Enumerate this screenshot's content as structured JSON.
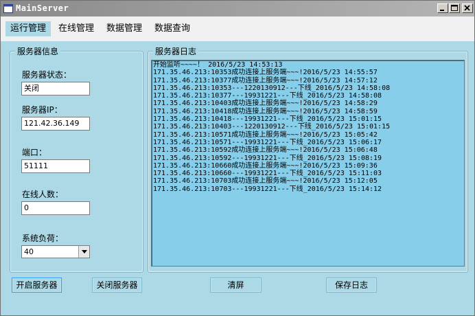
{
  "window": {
    "title": "MainServer",
    "controls": {
      "minimize": "minimize-icon",
      "maximize": "maximize-icon",
      "close": "close-icon"
    }
  },
  "menu": {
    "items": [
      {
        "label": "运行管理",
        "active": true
      },
      {
        "label": "在线管理"
      },
      {
        "label": "数据管理"
      },
      {
        "label": "数据查询"
      }
    ]
  },
  "server_info": {
    "title": "服务器信息",
    "status_label": "服务器状态：",
    "status_value": "关闭",
    "ip_label": "服务器IP：",
    "ip_value": "121.42.36.149",
    "port_label": "端口：",
    "port_value": "51111",
    "online_label": "在线人数：",
    "online_value": "0",
    "load_label": "系统负荷：",
    "load_value": "40"
  },
  "server_log": {
    "title": "服务器日志",
    "lines": [
      "开始监听~~~~！ 2016/5/23 14:53:13",
      "171.35.46.213:10353成功连接上服务端~~~!2016/5/23 14:55:57",
      "171.35.46.213:10377成功连接上服务端~~~!2016/5/23 14:57:12",
      "171.35.46.213:10353---1220130912---下线_2016/5/23 14:58:08",
      "171.35.46.213:10377---19931221---下线_2016/5/23 14:58:08",
      "171.35.46.213:10403成功连接上服务端~~~!2016/5/23 14:58:29",
      "171.35.46.213:10418成功连接上服务端~~~!2016/5/23 14:58:59",
      "171.35.46.213:10418---19931221---下线_2016/5/23 15:01:15",
      "171.35.46.213:10403---1220130912---下线_2016/5/23 15:01:15",
      "171.35.46.213:10571成功连接上服务端~~~!2016/5/23 15:05:42",
      "171.35.46.213:10571---19931221---下线_2016/5/23 15:06:17",
      "171.35.46.213:10592成功连接上服务端~~~!2016/5/23 15:06:48",
      "171.35.46.213:10592---19931221---下线_2016/5/23 15:08:19",
      "171.35.46.213:10660成功连接上服务端~~~!2016/5/23 15:09:36",
      "171.35.46.213:10660---19931221---下线_2016/5/23 15:11:03",
      "171.35.46.213:10703成功连接上服务端~~~!2016/5/23 15:12:05",
      "171.35.46.213:10703---19931221---下线_2016/5/23 15:14:12"
    ]
  },
  "buttons": {
    "start": "开启服务器",
    "stop": "关闭服务器",
    "clear": "清屏",
    "save": "保存日志"
  },
  "colors": {
    "window_bg": "#add8e6",
    "log_bg": "#87ceeb",
    "menu_bg": "#f0f0f0",
    "titlebar": "#9a9a9a"
  }
}
